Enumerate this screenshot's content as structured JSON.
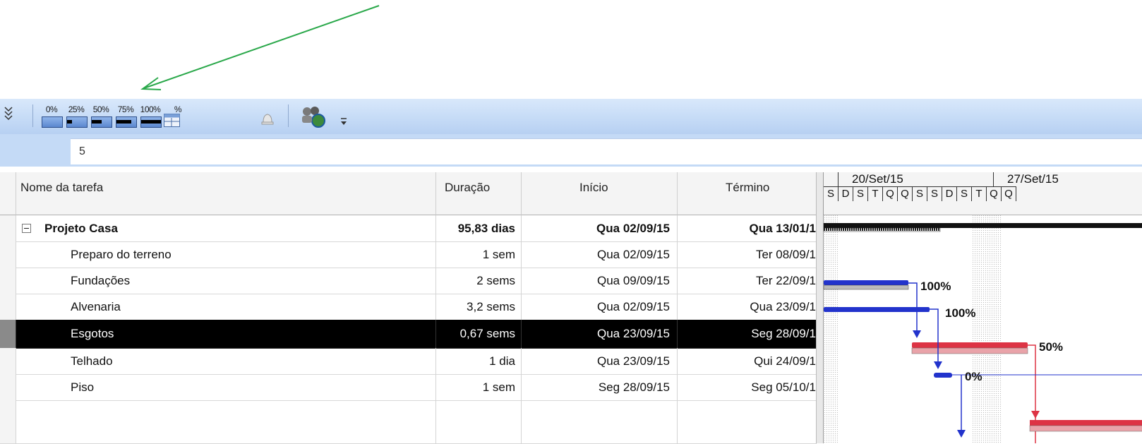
{
  "toolbar": {
    "buttons": [
      {
        "label": "0%",
        "value": 0
      },
      {
        "label": "25%",
        "value": 25
      },
      {
        "label": "50%",
        "value": 50
      },
      {
        "label": "75%",
        "value": 75
      },
      {
        "label": "100%",
        "value": 100
      }
    ],
    "update_as_scheduled_label": "%"
  },
  "entry_bar": {
    "value": "5"
  },
  "columns": {
    "name": "Nome da tarefa",
    "duration": "Duração",
    "start": "Início",
    "finish": "Término"
  },
  "rows": [
    {
      "name": "Projeto Casa",
      "duration": "95,83 dias",
      "start": "Qua 02/09/15",
      "finish": "Qua 13/01/1"
    },
    {
      "name": "Preparo do terreno",
      "duration": "1 sem",
      "start": "Qua 02/09/15",
      "finish": "Ter 08/09/1"
    },
    {
      "name": "Fundações",
      "duration": "2 sems",
      "start": "Qua 09/09/15",
      "finish": "Ter 22/09/1"
    },
    {
      "name": "Alvenaria",
      "duration": "3,2 sems",
      "start": "Qua 02/09/15",
      "finish": "Qua 23/09/1"
    },
    {
      "name": "Esgotos",
      "duration": "0,67 sems",
      "start": "Qua 23/09/15",
      "finish": "Seg 28/09/1"
    },
    {
      "name": "Telhado",
      "duration": "1 dia",
      "start": "Qua 23/09/15",
      "finish": "Qui 24/09/1"
    },
    {
      "name": "Piso",
      "duration": "1 sem",
      "start": "Seg 28/09/15",
      "finish": "Seg 05/10/1"
    }
  ],
  "timescale": {
    "weeks": [
      "20/Set/15",
      "27/Set/15"
    ],
    "days": [
      "S",
      "D",
      "S",
      "T",
      "Q",
      "Q",
      "S",
      "S",
      "D",
      "S",
      "T",
      "Q",
      "Q"
    ]
  },
  "gantt_labels": {
    "fundacoes": "100%",
    "alvenaria": "100%",
    "esgotos": "50%",
    "telhado": "0%"
  },
  "colors": {
    "toolbar": "#c4daf6",
    "selected_row": "#000000",
    "bar_blue": "#3344cc",
    "bar_red": "#dd3344",
    "arrow_annotation": "#2aa84a"
  }
}
